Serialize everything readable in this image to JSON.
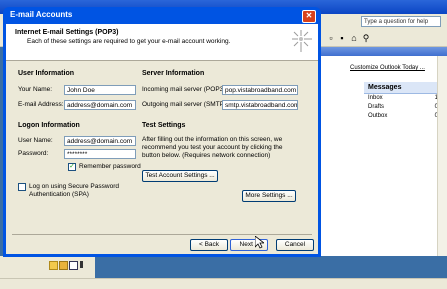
{
  "background": {
    "help_box_placeholder": "Type a question for help",
    "customize_link": "Customize Outlook Today ...",
    "messages": {
      "title": "Messages",
      "rows": [
        {
          "label": "Inbox",
          "count": "1"
        },
        {
          "label": "Drafts",
          "count": "0"
        },
        {
          "label": "Outbox",
          "count": "0"
        }
      ]
    }
  },
  "dialog": {
    "title": "E-mail Accounts",
    "close_glyph": "✕",
    "header": {
      "title": "Internet E-mail Settings (POP3)",
      "subtitle": "Each of these settings are required to get your e-mail account working."
    },
    "user_info": {
      "section": "User Information",
      "name_label": "Your Name:",
      "name_value": "John Doe",
      "email_label": "E-mail Address:",
      "email_value": "address@domain.com"
    },
    "server_info": {
      "section": "Server Information",
      "incoming_label": "Incoming mail server (POP3):",
      "incoming_value": "pop.vistabroadband.com",
      "outgoing_label": "Outgoing mail server (SMTP):",
      "outgoing_value": "smtp.vistabroadband.com"
    },
    "logon_info": {
      "section": "Logon Information",
      "username_label": "User Name:",
      "username_value": "address@domain.com",
      "password_label": "Password:",
      "password_value": "********",
      "remember_label": "Remember password",
      "remember_checked": true,
      "spa_label_line1": "Log on using Secure Password",
      "spa_label_line2": "Authentication (SPA)",
      "spa_checked": false
    },
    "test_settings": {
      "section": "Test Settings",
      "description": "After filling out the information on this screen, we recommend you test your account by clicking the button below. (Requires network connection)",
      "test_button": "Test Account Settings ...",
      "more_button": "More Settings ..."
    },
    "footer": {
      "back_button": "< Back",
      "next_button": "Next >",
      "cancel_button": "Cancel"
    }
  }
}
